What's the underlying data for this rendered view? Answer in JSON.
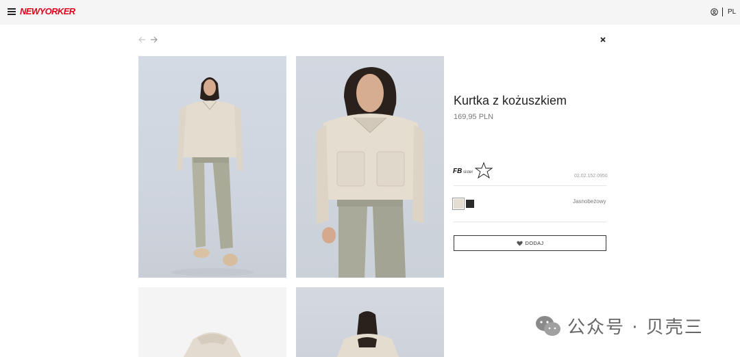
{
  "header": {
    "logo_text": "NEWYORKER",
    "language": "PL"
  },
  "product": {
    "title": "Kurtka z kożuszkiem",
    "price": "169,95 PLN",
    "brand_logo": "FBsister",
    "sku": "02.02.152.0950",
    "selected_color_name": "Jasnobeżowy",
    "colors": [
      "#e5ddd2",
      "#2b2b2b"
    ],
    "add_button_label": "DODAJ"
  },
  "watermark": {
    "text": "公众号 · 贝壳三"
  },
  "colors": {
    "brand_red": "#e2001a",
    "topbar_bg": "#f5f5f5"
  }
}
